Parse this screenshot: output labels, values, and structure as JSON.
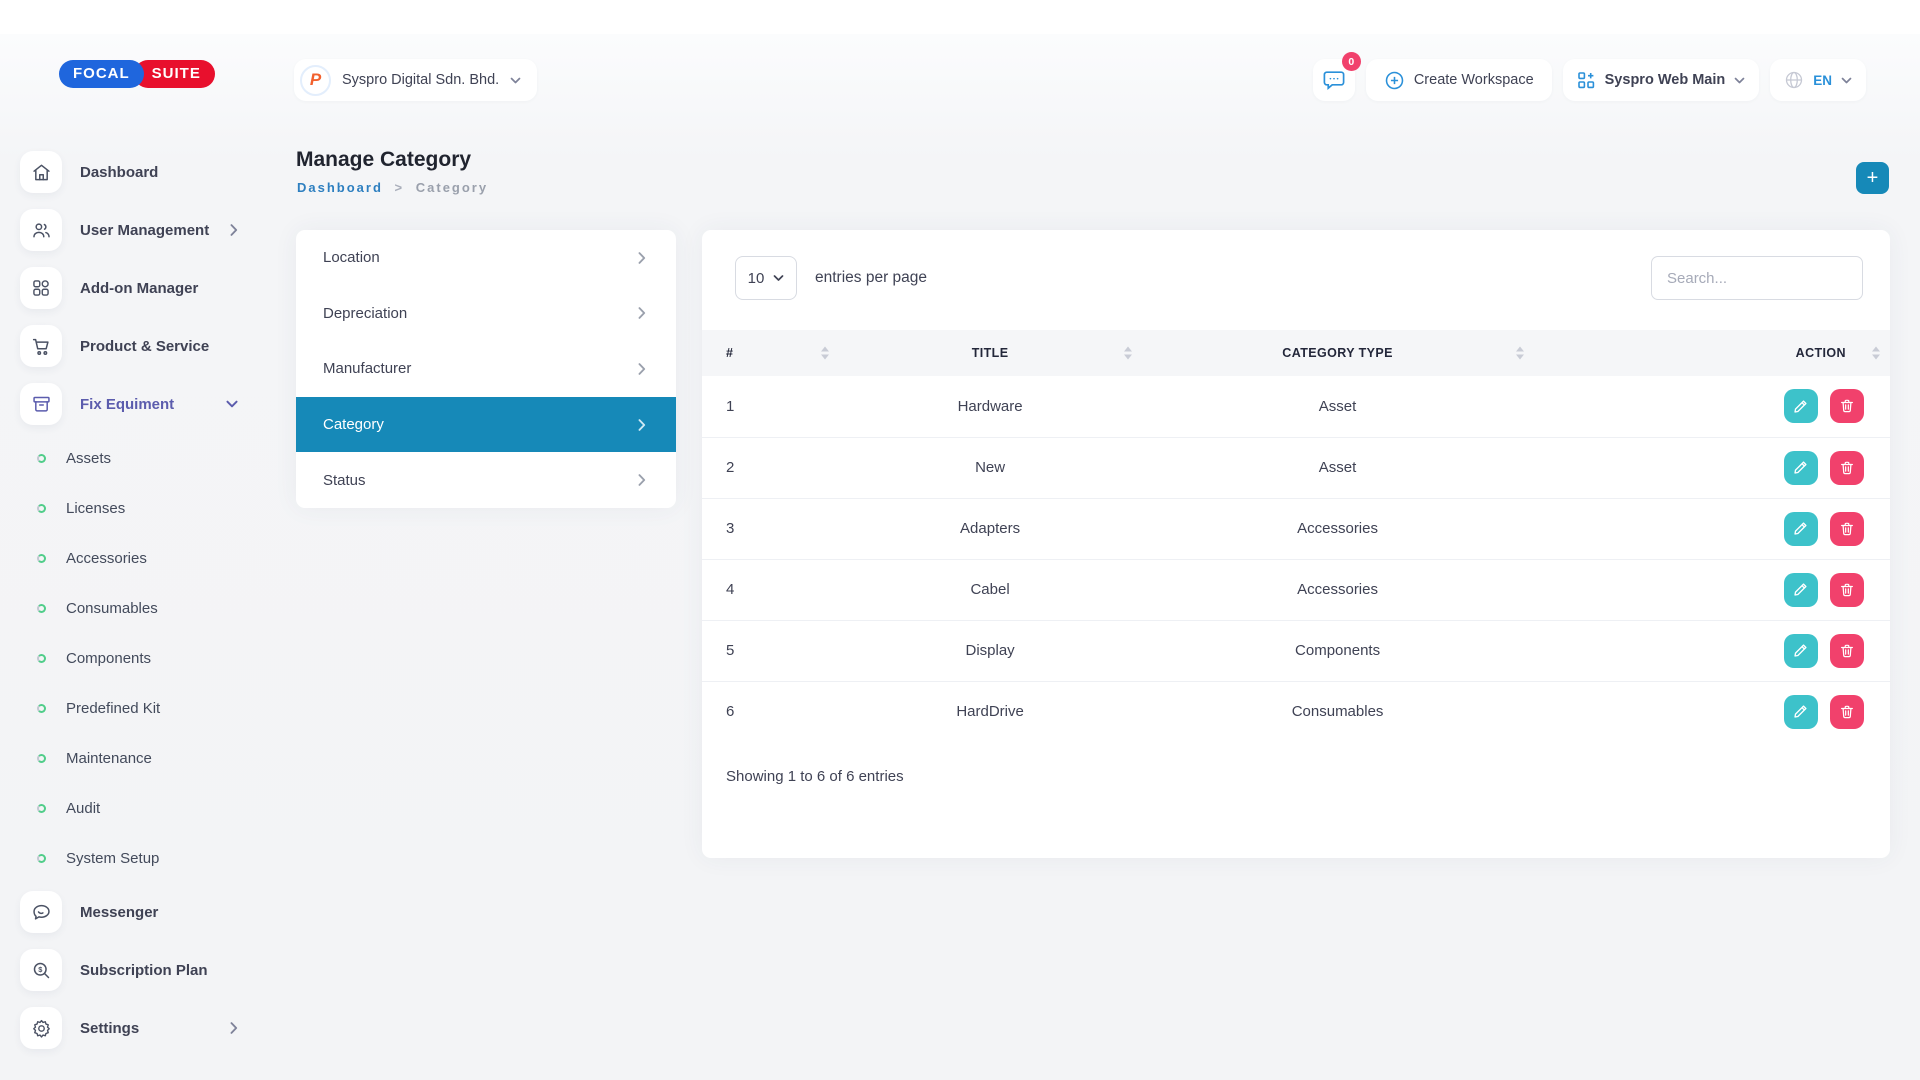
{
  "brand": {
    "focal": "FOCAL",
    "suite": "SUITE"
  },
  "header": {
    "workspace_name": "Syspro Digital Sdn. Bhd.",
    "chat_badge": "0",
    "create_workspace_label": "Create Workspace",
    "app_menu_label": "Syspro Web Main",
    "language_code": "EN"
  },
  "sidebar": {
    "items": [
      {
        "label": "Dashboard",
        "icon": "home"
      },
      {
        "label": "User Management",
        "icon": "users",
        "chevron": "right"
      },
      {
        "label": "Add-on Manager",
        "icon": "grid"
      },
      {
        "label": "Product & Service",
        "icon": "cart"
      },
      {
        "label": "Fix Equiment",
        "icon": "archive",
        "chevron": "down",
        "active": true
      },
      {
        "label": "Assets",
        "sub": true
      },
      {
        "label": "Licenses",
        "sub": true
      },
      {
        "label": "Accessories",
        "sub": true
      },
      {
        "label": "Consumables",
        "sub": true
      },
      {
        "label": "Components",
        "sub": true
      },
      {
        "label": "Predefined Kit",
        "sub": true
      },
      {
        "label": "Maintenance",
        "sub": true
      },
      {
        "label": "Audit",
        "sub": true
      },
      {
        "label": "System Setup",
        "sub": true
      },
      {
        "label": "Messenger",
        "icon": "chat"
      },
      {
        "label": "Subscription Plan",
        "icon": "search-dollar"
      },
      {
        "label": "Settings",
        "icon": "gear",
        "chevron": "right"
      }
    ]
  },
  "page": {
    "title": "Manage Category",
    "breadcrumb_home": "Dashboard",
    "breadcrumb_sep": ">",
    "breadcrumb_current": "Category",
    "add_label": "+"
  },
  "submenu": {
    "items": [
      {
        "label": "Location"
      },
      {
        "label": "Depreciation"
      },
      {
        "label": "Manufacturer"
      },
      {
        "label": "Category",
        "active": true
      },
      {
        "label": "Status"
      }
    ]
  },
  "table": {
    "entries_value": "10",
    "entries_label": "entries per page",
    "search_placeholder": "Search...",
    "columns": [
      "#",
      "TITLE",
      "CATEGORY TYPE",
      "ACTION"
    ],
    "rows": [
      {
        "num": "1",
        "title": "Hardware",
        "type": "Asset"
      },
      {
        "num": "2",
        "title": "New",
        "type": "Asset"
      },
      {
        "num": "3",
        "title": "Adapters",
        "type": "Accessories"
      },
      {
        "num": "4",
        "title": "Cabel",
        "type": "Accessories"
      },
      {
        "num": "5",
        "title": "Display",
        "type": "Components"
      },
      {
        "num": "6",
        "title": "HardDrive",
        "type": "Consumables"
      }
    ],
    "footer": "Showing 1 to 6 of 6 entries"
  },
  "colors": {
    "accent": "#1689b8",
    "active_purple": "#5b5cad",
    "success": "#50cd89",
    "edit": "#3dc2ca",
    "delete": "#f1416c",
    "brand_blue": "#1f66dd",
    "brand_red": "#e8102d",
    "link": "#2d7fc0",
    "icon_blue": "#2a90d9"
  }
}
